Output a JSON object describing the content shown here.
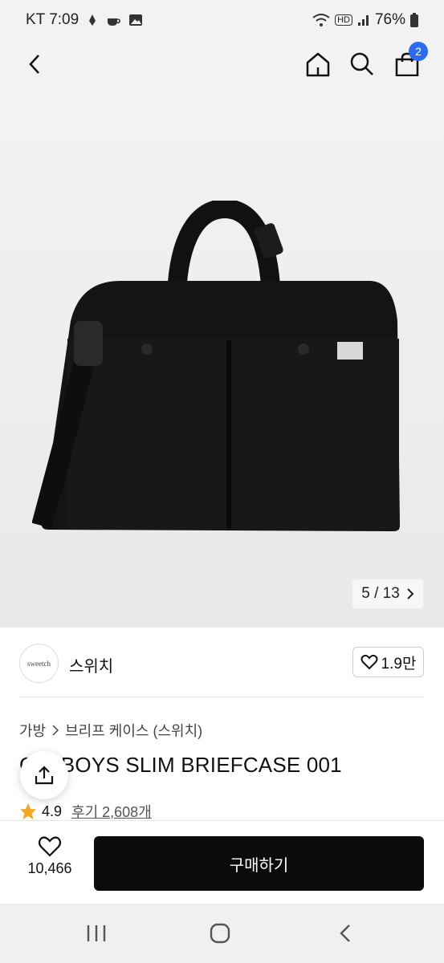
{
  "status_bar": {
    "carrier_time": "KT 7:09",
    "battery": "76%",
    "hd_label": "HD"
  },
  "nav": {
    "cart_count": "2",
    "icons": [
      "back-arrow-icon",
      "home-icon",
      "search-icon",
      "shopping-bag-icon"
    ]
  },
  "gallery": {
    "counter": "5 / 13"
  },
  "brand": {
    "logo_text": "sweetch",
    "name": "스위치",
    "likes": "1.9만"
  },
  "product": {
    "breadcrumb": [
      "가방",
      "브리프 케이스 (스위치)"
    ],
    "title": "G  Y BOYS SLIM BRIEFCASE 001",
    "rating": "4.9",
    "reviews": "후기 2,608개"
  },
  "action_bar": {
    "wish_count": "10,466",
    "buy_label": "구매하기"
  },
  "colors": {
    "accent_badge": "#2b6cf0",
    "buy_button": "#0b0b0b",
    "star": "#f5a623"
  }
}
